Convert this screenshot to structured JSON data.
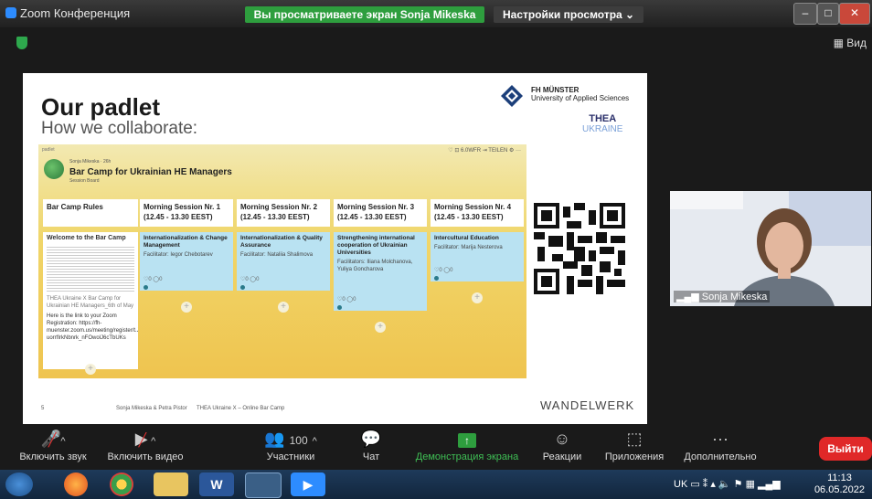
{
  "window": {
    "app_title": "Zoom Конференция",
    "share_banner": "Вы просматриваете экран Sonja Mikeska",
    "view_settings": "Настройки просмотра",
    "view_button": "Вид"
  },
  "slide": {
    "title": "Our padlet",
    "subtitle": "How we collaborate:",
    "fh_name": "FH MÜNSTER",
    "fh_sub": "University of Applied Sciences",
    "thea": "THEA",
    "thea_sub": "UKRAINE",
    "footer_page": "5",
    "footer_authors": "Sonja Mikeska & Petra Pistor",
    "footer_event": "THEA Ukraine X – Online Bar Camp",
    "brand": "WANDELWERK",
    "padlet": {
      "header": "padlet",
      "author": "Sonja Mikeska · 26h",
      "title": "Bar Camp for Ukrainian HE Managers",
      "board": "Session Board",
      "toolbar": "♡  ⊡ 6.0WFR  ⇥ TEILEN  ⚙  ···",
      "columns": [
        {
          "head": "Bar Camp Rules"
        },
        {
          "head": "Morning Session Nr. 1 (12.45 - 13.30 EEST)",
          "card_title": "Internationalization & Change Management",
          "facilitator": "Facilitator: Iegor Chebotarev"
        },
        {
          "head": "Morning Session Nr. 2 (12.45 - 13.30 EEST)",
          "card_title": "Internationalization & Quality Assurance",
          "facilitator": "Facilitator: Nataliia Shalimova"
        },
        {
          "head": "Morning Session Nr. 3 (12.45 - 13.30 EEST)",
          "card_title": "Strengthening international cooperation of Ukrainian Universities",
          "facilitator": "Facilitators: Iliana Molchanova, Yuliya Goncharova"
        },
        {
          "head": "Morning Session Nr. 4 (12.45 - 13.30 EEST)",
          "card_title": "Intercultural Education",
          "facilitator": "Facilitator: Marija Nesterova"
        }
      ],
      "welcome_title": "Welcome to the Bar Camp",
      "welcome_caption": "THEA Ukraine X Bar Camp for Ukrainian HE Managers_6th of May",
      "welcome_text": "Here is the link to your Zoom Registration: https://fh-muenster.zoom.us/meeting/register/t.JIc-uorrfIrkNbnrk_nFOwolJ6cTbUKs",
      "card_meta": "♡0     ◯0",
      "plus": "+"
    }
  },
  "video": {
    "name": "Sonja Mikeska"
  },
  "toolbar": {
    "mute": "Включить звук",
    "video": "Включить видео",
    "participants": "Участники",
    "participants_count": "100",
    "chat": "Чат",
    "share": "Демонстрация экрана",
    "reactions": "Реакции",
    "apps": "Приложения",
    "more": "Дополнительно",
    "leave": "Выйти"
  },
  "taskbar": {
    "lang": "UK",
    "time": "11:13",
    "date": "06.05.2022"
  },
  "colors": {
    "share_green": "#2e9e3e",
    "leave_red": "#e02828",
    "padlet_yellow": "#f0d66a",
    "card_blue": "#b9e2f2"
  }
}
